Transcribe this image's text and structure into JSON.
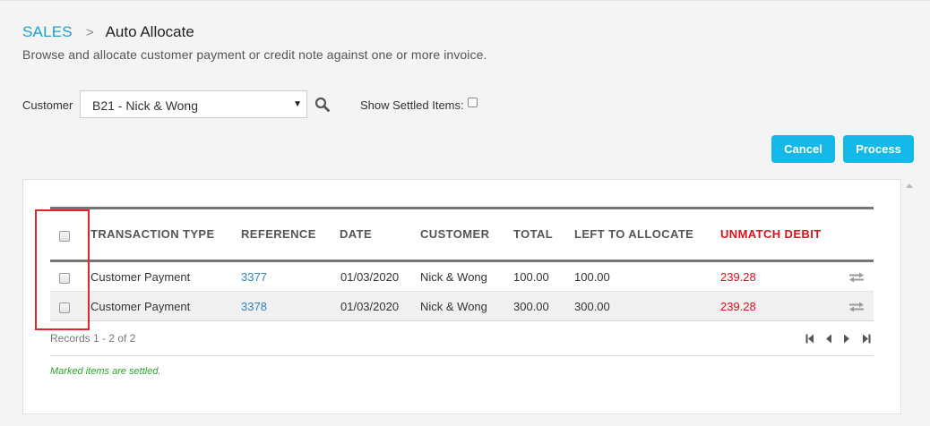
{
  "breadcrumb": {
    "root": "SALES",
    "separator": ">",
    "page": "Auto Allocate"
  },
  "subtitle": "Browse and allocate customer payment or credit note against one or more invoice.",
  "filters": {
    "customer_label": "Customer",
    "customer_value": "B21 - Nick & Wong",
    "settled_label": "Show Settled Items:",
    "settled_checked": false
  },
  "buttons": {
    "cancel": "Cancel",
    "process": "Process"
  },
  "table": {
    "headers": {
      "transaction_type": "TRANSACTION TYPE",
      "reference": "REFERENCE",
      "date": "DATE",
      "customer": "CUSTOMER",
      "total": "TOTAL",
      "left_to_allocate": "LEFT TO ALLOCATE",
      "unmatch_debit": "UNMATCH DEBIT"
    },
    "rows": [
      {
        "type": "Customer Payment",
        "reference": "3377",
        "date": "01/03/2020",
        "customer": "Nick & Wong",
        "total": "100.00",
        "left": "100.00",
        "unmatch": "239.28"
      },
      {
        "type": "Customer Payment",
        "reference": "3378",
        "date": "01/03/2020",
        "customer": "Nick & Wong",
        "total": "300.00",
        "left": "300.00",
        "unmatch": "239.28"
      }
    ]
  },
  "records_text": "Records 1 - 2 of 2",
  "note": "Marked items are settled.",
  "icons": {
    "search": "search-icon",
    "swap": "swap-icon",
    "pager": [
      "first-page-icon",
      "prev-page-icon",
      "next-page-icon",
      "last-page-icon"
    ]
  },
  "colors": {
    "accent": "#14b9ea",
    "link": "#2a86c8",
    "danger": "#e0101a",
    "note": "#2aa62a"
  }
}
